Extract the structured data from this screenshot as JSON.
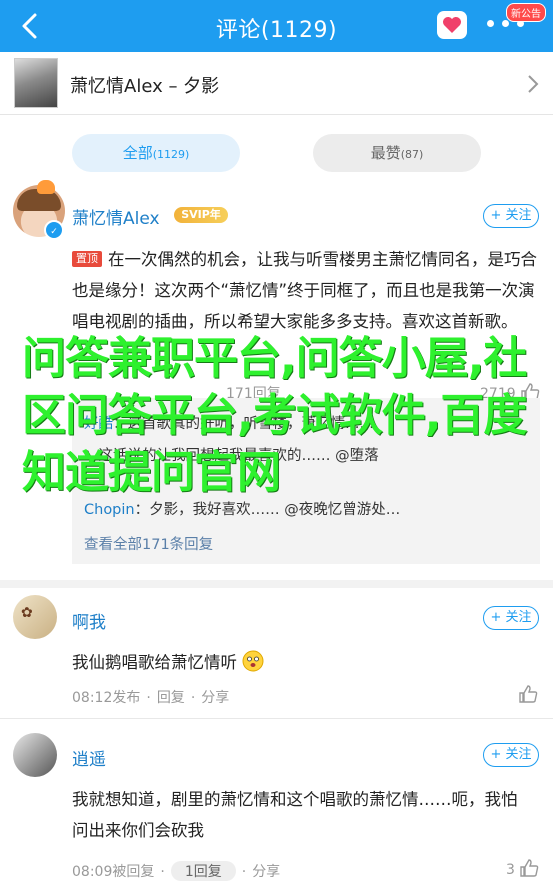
{
  "header": {
    "title": "评论(1129)",
    "notice_badge": "新公告",
    "accent_color": "#1e9df0"
  },
  "song": {
    "title": "萧忆情Alex – 夕影"
  },
  "filters": {
    "all_label": "全部",
    "all_count": "(1129)",
    "hot_label": "最赞",
    "hot_count": "(87)"
  },
  "comments": [
    {
      "username": "萧忆情Alex",
      "vip_badge": "SVIP年",
      "follow_label": "+ 关注",
      "pin_tag": "置顶",
      "text": "在一次偶然的机会，让我与听雪楼男主萧忆情同名，是巧合也是缘分！这次两个“萧忆情”终于同框了，而且也是我第一次演唱电视剧的插曲，所以希望大家能多多支持。喜欢这首新歌。",
      "time": "",
      "reply_label": "171回复",
      "likes": "2719",
      "replies": [
        {
          "name": "好酷",
          "text": "：这首歌真的好听，听雪楼，萧忆情……"
        },
        {
          "name": "",
          "text": "：这话说的让我回想起我最喜欢的…… @堕落"
        },
        {
          "name": "Chopin",
          "text": "：夕影，我好喜欢……  @夜晚忆曾游处…"
        }
      ],
      "view_all": "查看全部171条回复"
    },
    {
      "username": "啊我",
      "follow_label": "+ 关注",
      "text": "我仙鹅唱歌给萧忆情听",
      "time": "08:12发布",
      "reply_label": "回复",
      "share_label": "分享",
      "likes": ""
    },
    {
      "username": "逍遥",
      "follow_label": "+ 关注",
      "text": "我就想知道，剧里的萧忆情和这个唱歌的萧忆情……呃，我怕问出来你们会砍我",
      "time": "08:09被回复",
      "reply_label": "1回复",
      "share_label": "分享",
      "likes": "3"
    }
  ],
  "overlay": {
    "text": "问答兼职平台,问答小屋,社区问答平台,考试软件,百度知道提问官网"
  }
}
